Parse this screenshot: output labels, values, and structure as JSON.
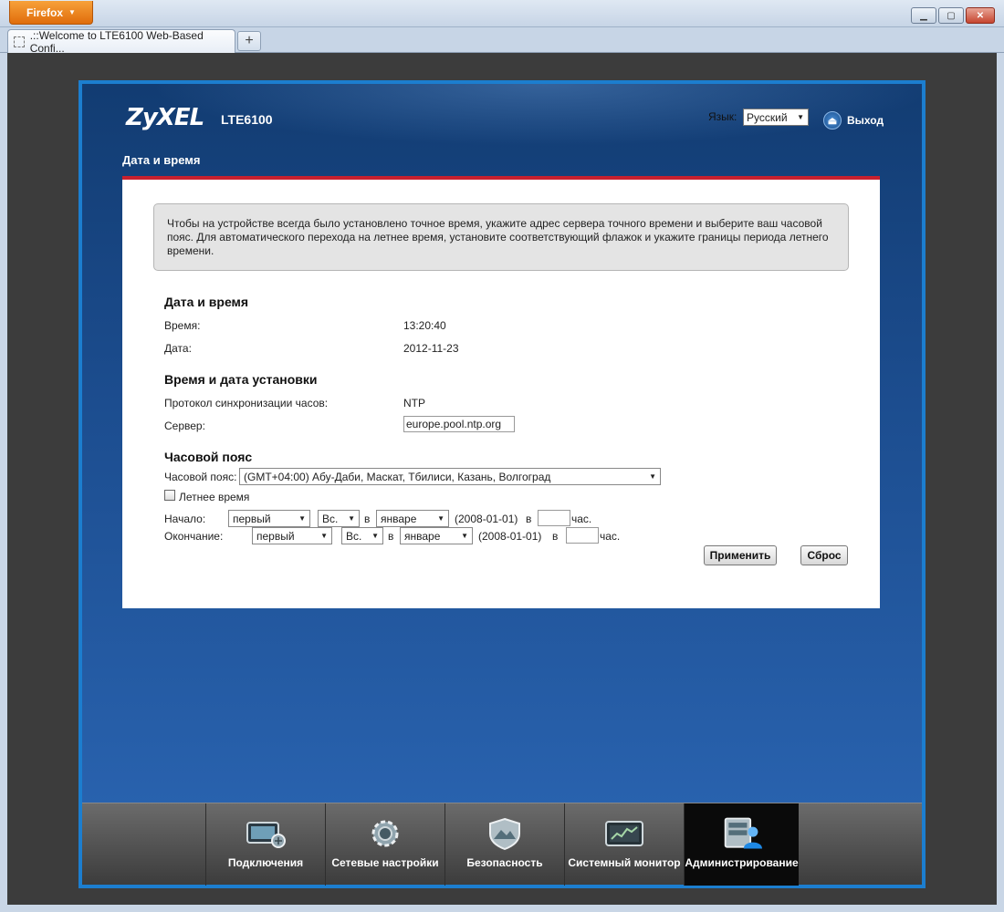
{
  "browser": {
    "menu_label": "Firefox",
    "tab_title": ".::Welcome to LTE6100 Web-Based Confi...",
    "new_tab": "+",
    "controls": {
      "minimize": "▁",
      "maximize": "▢",
      "close": "✕"
    }
  },
  "header": {
    "brand": "ZyXEL",
    "model": "LTE6100",
    "language_label": "Язык:",
    "language_value": "Русский",
    "logout_label": "Выход"
  },
  "page": {
    "title": "Дата и время",
    "info": "Чтобы на устройстве всегда было установлено точное время, укажите адрес сервера точного времени и выберите ваш часовой пояс. Для автоматического перехода на летнее время, установите соответствующий флажок и укажите границы периода летнего времени."
  },
  "datetime": {
    "section": "Дата и время",
    "time_label": "Время:",
    "time_value": "13:20:40",
    "date_label": "Дата:",
    "date_value": "2012-11-23"
  },
  "setup": {
    "section": "Время и дата установки",
    "protocol_label": "Протокол синхронизации часов:",
    "protocol_value": "NTP",
    "server_label": "Сервер:",
    "server_value": "europe.pool.ntp.org"
  },
  "timezone": {
    "section": "Часовой пояс",
    "tz_label": "Часовой пояс:",
    "tz_value": "(GMT+04:00) Абу-Даби, Маскат, Тбилиси, Казань, Волгоград",
    "dst_label": "Летнее время",
    "start": {
      "label": "Начало:",
      "week": "первый",
      "day": "Вс.",
      "in1": "в",
      "month": "январе",
      "date": "(2008-01-01)",
      "in2": "в",
      "hour": "",
      "unit": "час."
    },
    "end": {
      "label": "Окончание:",
      "week": "первый",
      "day": "Вс.",
      "in1": "в",
      "month": "январе",
      "date": "(2008-01-01)",
      "in2": "в",
      "hour": "",
      "unit": "час."
    }
  },
  "actions": {
    "apply": "Применить",
    "reset": "Сброс"
  },
  "nav": {
    "items": [
      {
        "label": "Подключения",
        "icon": "connection-monitor-icon"
      },
      {
        "label": "Сетевые настройки",
        "icon": "gear-icon"
      },
      {
        "label": "Безопасность",
        "icon": "shield-icon"
      },
      {
        "label": "Системный монитор",
        "icon": "system-monitor-icon"
      },
      {
        "label": "Администрирование",
        "icon": "admin-icon"
      }
    ],
    "active": "Администрирование"
  }
}
